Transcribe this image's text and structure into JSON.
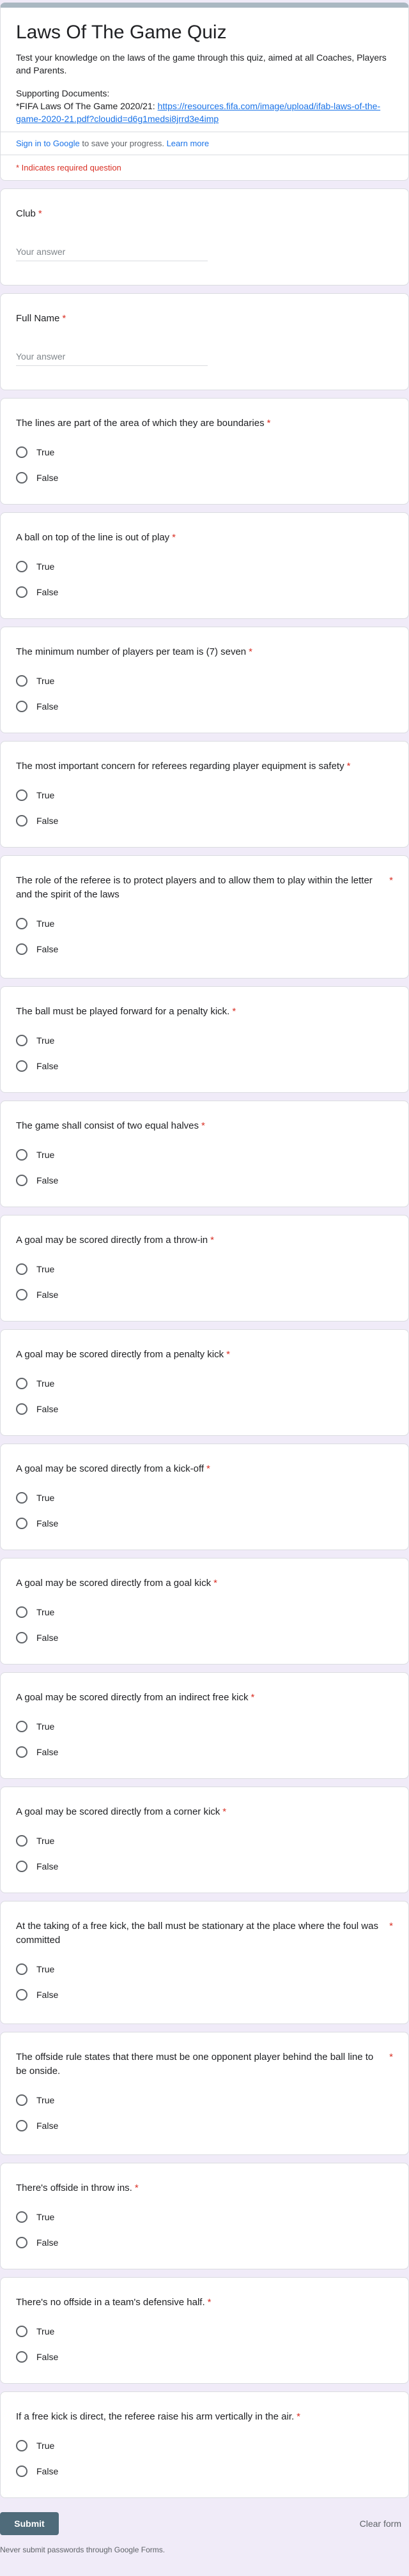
{
  "form": {
    "title": "Laws Of The Game Quiz",
    "description": "Test your knowledge on the laws of the game through this quiz, aimed at all Coaches, Players and Parents.",
    "supporting_heading": "Supporting Documents:",
    "supporting_prefix": "*FIFA Laws Of The Game 2020/21: ",
    "supporting_link": "https://resources.fifa.com/image/upload/ifab-laws-of-the-game-2020-21.pdf?cloudid=d6g1medsi8jrrd3e4imp",
    "signin_link": "Sign in to Google",
    "signin_text": " to save your progress. ",
    "learn_more": "Learn more",
    "required_note": "* Indicates required question",
    "required_star": "*",
    "accent_color": "#aab8c2"
  },
  "text_fields": [
    {
      "label": "Club",
      "placeholder": "Your answer"
    },
    {
      "label": "Full Name",
      "placeholder": "Your answer"
    }
  ],
  "questions": [
    {
      "text": "The lines are part of the area of which they are boundaries",
      "true": "True",
      "false": "False"
    },
    {
      "text": "A ball on top of the line is out of play",
      "true": "True",
      "false": "False"
    },
    {
      "text": "The minimum number of players per team is (7) seven",
      "true": "True",
      "false": "False"
    },
    {
      "text": "The most important concern for referees regarding player equipment is safety",
      "true": "True",
      "false": "False"
    },
    {
      "text": "The role of the referee is to protect players and to allow them to play within the letter and the spirit of the laws",
      "true": "True",
      "false": "False"
    },
    {
      "text": "The ball must be played forward for a penalty kick.",
      "true": "True",
      "false": "False"
    },
    {
      "text": "The game shall consist of two equal halves",
      "true": "True",
      "false": "False"
    },
    {
      "text": "A goal may be scored directly from a throw-in",
      "true": "True",
      "false": "False"
    },
    {
      "text": "A goal may be scored directly from a penalty kick",
      "true": "True",
      "false": "False"
    },
    {
      "text": "A goal may be scored directly from a kick-off",
      "true": "True",
      "false": "False"
    },
    {
      "text": "A goal may be scored directly from a goal kick",
      "true": "True",
      "false": "False"
    },
    {
      "text": "A goal may be scored directly from an indirect free kick",
      "true": "True",
      "false": "False"
    },
    {
      "text": "A goal may be scored directly from a corner kick",
      "true": "True",
      "false": "False"
    },
    {
      "text": "At the taking of a free kick, the ball must be stationary at the place where the foul was committed",
      "true": "True",
      "false": "False"
    },
    {
      "text": "The offside rule states that there must be one opponent player behind the ball line to be onside.",
      "true": "True",
      "false": "False"
    },
    {
      "text": "There's offside in throw ins.",
      "true": "True",
      "false": "False"
    },
    {
      "text": "There's no offside in a team's defensive half.",
      "true": "True",
      "false": "False"
    },
    {
      "text": "If a free kick is direct, the referee raise his arm vertically in the air.",
      "true": "True",
      "false": "False"
    }
  ],
  "footer": {
    "submit": "Submit",
    "clear": "Clear form",
    "never_submit": "Never submit passwords through Google Forms."
  }
}
